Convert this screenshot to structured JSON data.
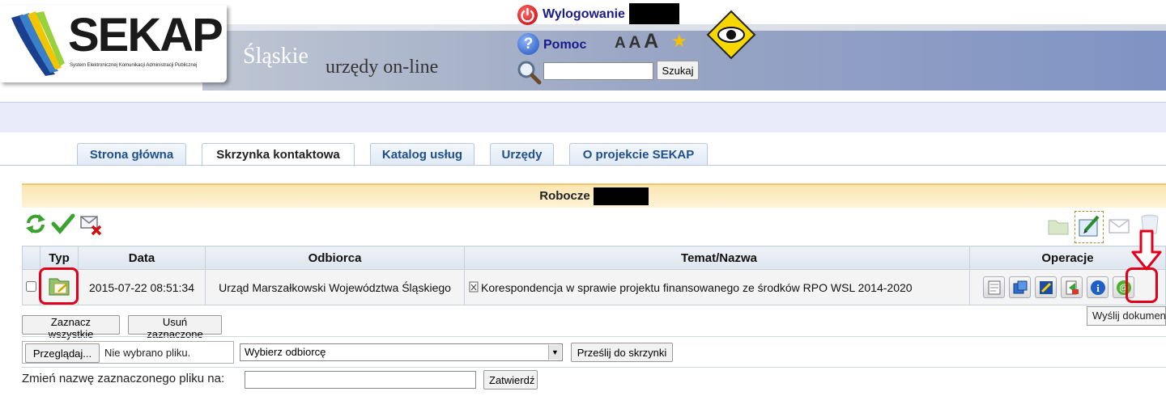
{
  "header": {
    "logo_text": "SEKAP",
    "logo_subtitle": "System Elektronicznej Komunikacji Administracji Publicznej",
    "region": "Śląskie",
    "tagline": "urzędy on-line",
    "logout_label": "Wylogowanie",
    "help_label": "Pomoc",
    "font_sizes": [
      "A",
      "A",
      "A"
    ],
    "search": {
      "value": "",
      "placeholder": "",
      "button_label": "Szukaj"
    }
  },
  "tabs": [
    {
      "label": "Strona główna",
      "active": false
    },
    {
      "label": "Skrzynka kontaktowa",
      "active": true
    },
    {
      "label": "Katalog usług",
      "active": false
    },
    {
      "label": "Urzędy",
      "active": false
    },
    {
      "label": "O projekcie SEKAP",
      "active": false
    }
  ],
  "mailbox": {
    "folder_title": "Robocze",
    "toolbar_left_icons": [
      "refresh-icon",
      "check-icon",
      "delete-mail-icon"
    ],
    "toolbar_right_icons": [
      "folder-icon",
      "edit-document-icon",
      "envelope-icon",
      "trash-icon"
    ],
    "columns": {
      "type": "Typ",
      "date": "Data",
      "recipient": "Odbiorca",
      "subject": "Temat/Nazwa",
      "operations": "Operacje"
    },
    "rows": [
      {
        "checked": false,
        "type_icon": "draft-document-icon",
        "date": "2015-07-22 08:51:34",
        "recipient": "Urząd Marszałkowski Województwa Śląskiego",
        "subject": "Korespondencja w sprawie projektu finansowanego ze środków RPO WSL 2014-2020",
        "operations": [
          "preview-icon",
          "windows-icon",
          "sign-icon",
          "forward-icon",
          "info-icon",
          "send-document-icon"
        ]
      }
    ],
    "tooltip": "Wyślij dokument",
    "select_all_label": "Zaznacz wszystkie",
    "delete_selected_label": "Usuń zaznaczone",
    "browse_label": "Przeglądaj...",
    "no_file_label": "Nie wybrano pliku.",
    "recipient_select_value": "Wybierz odbiorcę",
    "upload_label": "Prześlij do skrzynki",
    "rename_label": "Zmień nazwę zaznaczonego pliku na:",
    "rename_value": "",
    "confirm_label": "Zatwierdź"
  },
  "colors": {
    "accent_red": "#e0001a",
    "tab_text": "#1f4f8c",
    "folder_bar": "#fbe5b0"
  }
}
